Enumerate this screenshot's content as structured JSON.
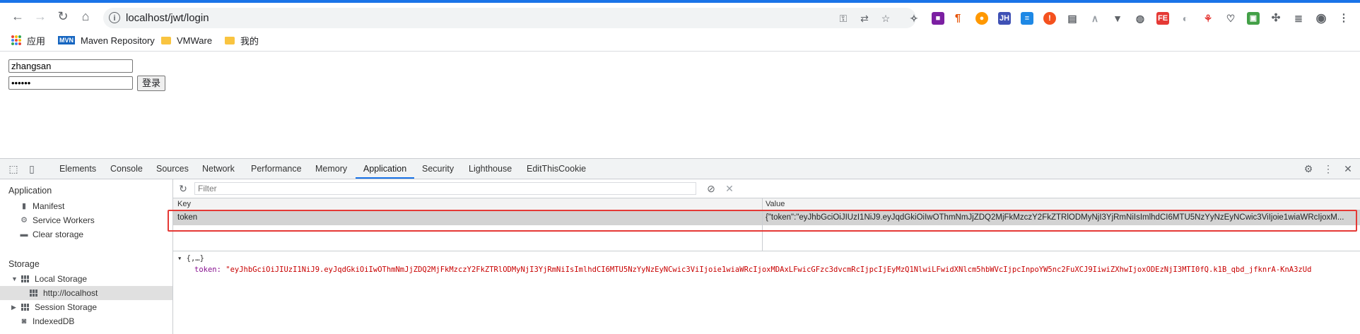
{
  "browser": {
    "url": "localhost/jwt/login",
    "bookmarks": [
      {
        "label": "应用",
        "icon": "apps-grid-icon"
      },
      {
        "label": "Maven Repository",
        "icon": "maven-icon",
        "badge": "MVN"
      },
      {
        "label": "VMWare",
        "icon": "folder-icon"
      },
      {
        "label": "我的",
        "icon": "folder-icon"
      }
    ]
  },
  "page": {
    "username_value": "zhangsan",
    "password_value": "••••••",
    "login_label": "登录"
  },
  "devtools": {
    "tabs": [
      "Elements",
      "Console",
      "Sources",
      "Network",
      "Performance",
      "Memory",
      "Application",
      "Security",
      "Lighthouse",
      "EditThisCookie"
    ],
    "active_tab": "Application",
    "sidebar": {
      "application_heading": "Application",
      "manifest": "Manifest",
      "service_workers": "Service Workers",
      "clear_storage": "Clear storage",
      "storage_heading": "Storage",
      "local_storage": "Local Storage",
      "local_origin": "http://localhost",
      "session_storage": "Session Storage",
      "indexeddb": "IndexedDB"
    },
    "filter_placeholder": "Filter",
    "table": {
      "headers": [
        "Key",
        "Value"
      ],
      "rows": [
        {
          "key": "token",
          "value": "{\"token\":\"eyJhbGciOiJIUzI1NiJ9.eyJqdGkiOiIwOThmNmJjZDQ2MjFkMzczY2FkZTRlODMyNjI3YjRmNiIsImlhdCI6MTU5NzYyNzEyNCwic3ViIjoie1wiaWRcIjoxM..."
        }
      ]
    },
    "preview": {
      "summary": "{,…}",
      "key": "token",
      "value": "\"eyJhbGciOiJIUzI1NiJ9.eyJqdGkiOiIwOThmNmJjZDQ2MjFkMzczY2FkZTRlODMyNjI3YjRmNiIsImlhdCI6MTU5NzYyNzEyNCwic3ViIjoie1wiaWRcIjoxMDAxLFwicGFzc3dvcmRcIjpcIjEyMzQ1NlwiLFwidXNlcm5hbWVcIjpcInpoYW5nc2FuXCJ9IiwiZXhwIjoxODEzNjI3MTI0fQ.k1B_qbd_jfknrA-KnA3zUd"
    },
    "colors": {
      "accent": "#1a73e8",
      "highlight_border": "#e53935",
      "preview_value": "#c80000",
      "preview_key": "#881391"
    }
  }
}
